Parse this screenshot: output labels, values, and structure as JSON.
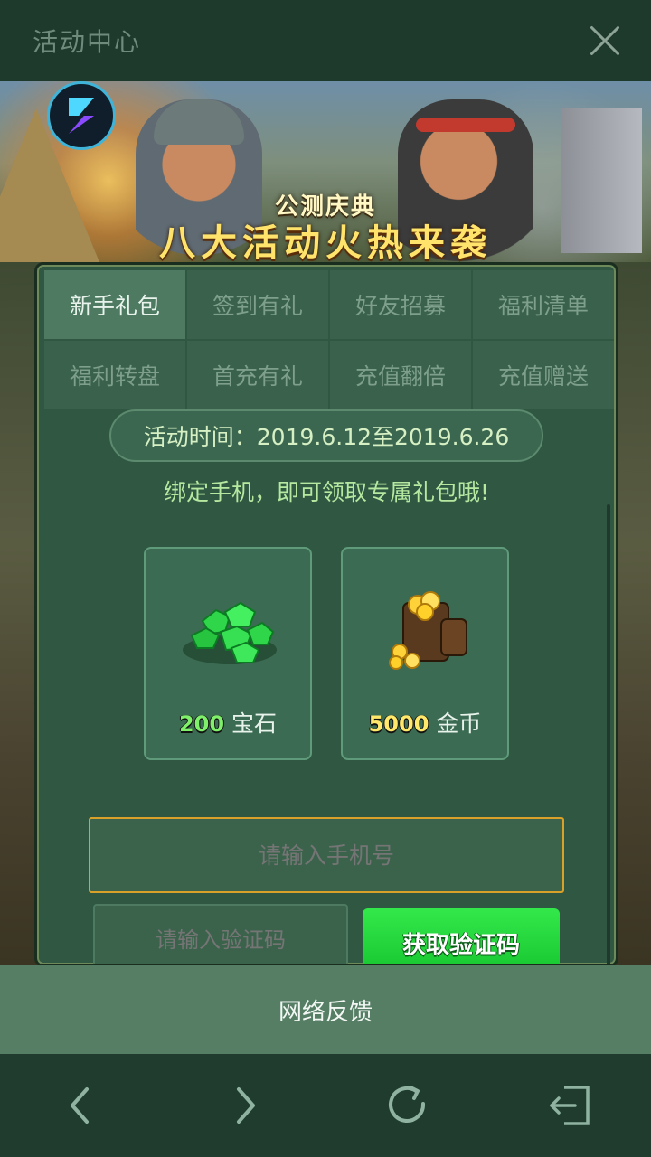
{
  "topbar": {
    "title": "活动中心"
  },
  "banner": {
    "subtitle": "公测庆典",
    "headline": "八大活动火热来袭"
  },
  "tabs": [
    {
      "label": "新手礼包",
      "active": true
    },
    {
      "label": "签到有礼",
      "active": false
    },
    {
      "label": "好友招募",
      "active": false
    },
    {
      "label": "福利清单",
      "active": false
    },
    {
      "label": "福利转盘",
      "active": false
    },
    {
      "label": "首充有礼",
      "active": false
    },
    {
      "label": "充值翻倍",
      "active": false
    },
    {
      "label": "充值赠送",
      "active": false
    }
  ],
  "event": {
    "time_text": "活动时间：2019.6.12至2019.6.26",
    "description": "绑定手机，即可领取专属礼包哦!"
  },
  "rewards": [
    {
      "amount": "200",
      "name": "宝石",
      "icon": "gem-icon"
    },
    {
      "amount": "5000",
      "name": "金币",
      "icon": "gold-coins-icon"
    }
  ],
  "form": {
    "phone_placeholder": "请输入手机号",
    "code_placeholder": "请输入验证码",
    "get_code_label": "获取验证码"
  },
  "feedback": {
    "label": "网络反馈"
  },
  "nav": {
    "icons": [
      "back-icon",
      "forward-icon",
      "refresh-icon",
      "exit-icon"
    ]
  },
  "colors": {
    "panel": "#2f5742",
    "accent_green": "#1fd83a",
    "gold": "#ffe36b",
    "input_border": "#d9a12a"
  }
}
